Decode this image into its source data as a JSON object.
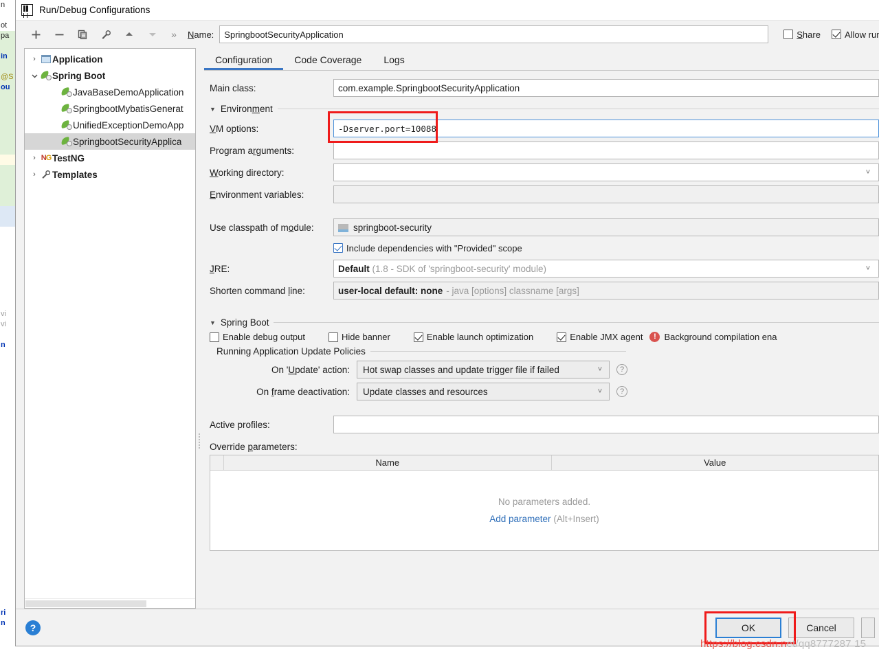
{
  "window": {
    "title": "Run/Debug Configurations",
    "logo_icon": "intellij-idea-logo-icon"
  },
  "toolbar": {
    "add_icon": "plus-icon",
    "remove_icon": "minus-icon",
    "copy_icon": "copy-icon",
    "edit_templates_icon": "wrench-icon",
    "move_up_icon": "arrow-up-icon",
    "move_down_icon": "arrow-down-icon",
    "overflow_label": "»"
  },
  "name_row": {
    "label": "Name:",
    "label_mnemonic": "N",
    "value": "SpringbootSecurityApplication",
    "share_label": "Share",
    "share_mnemonic": "S",
    "share_checked": false,
    "allow_running_label": "Allow running",
    "allow_running_checked": true
  },
  "tree": {
    "items": [
      {
        "label": "Application",
        "icon": "application-icon",
        "twisty": "›",
        "level": 0,
        "bold": true,
        "selected": false
      },
      {
        "label": "Spring Boot",
        "icon": "spring-boot-icon",
        "twisty": "⌄",
        "level": 0,
        "bold": true,
        "selected": false
      },
      {
        "label": "JavaBaseDemoApplication",
        "icon": "spring-leaf-icon",
        "twisty": "",
        "level": 1,
        "bold": false,
        "selected": false
      },
      {
        "label": "SpringbootMybatisGenerat",
        "icon": "spring-leaf-icon",
        "twisty": "",
        "level": 1,
        "bold": false,
        "selected": false
      },
      {
        "label": "UnifiedExceptionDemoApp",
        "icon": "spring-leaf-icon",
        "twisty": "",
        "level": 1,
        "bold": false,
        "selected": false
      },
      {
        "label": "SpringbootSecurityApplica",
        "icon": "spring-leaf-icon",
        "twisty": "",
        "level": 1,
        "bold": false,
        "selected": true
      },
      {
        "label": "TestNG",
        "icon": "testng-icon",
        "twisty": "›",
        "level": 0,
        "bold": true,
        "selected": false
      },
      {
        "label": "Templates",
        "icon": "wrench-icon",
        "twisty": "›",
        "level": 0,
        "bold": true,
        "selected": false
      }
    ]
  },
  "tabs": [
    {
      "label": "Configuration",
      "active": true
    },
    {
      "label": "Code Coverage",
      "active": false
    },
    {
      "label": "Logs",
      "active": false
    }
  ],
  "form": {
    "main_class": {
      "label": "Main class:",
      "value": "com.example.SpringbootSecurityApplication"
    },
    "environment_section": {
      "title": "Environment",
      "mnemonic": "m",
      "expanded": true,
      "triangle": "▼"
    },
    "vm_options": {
      "label": "VM options:",
      "label_mnemonic": "V",
      "value": "-Dserver.port=10088",
      "highlighted": true
    },
    "program_arguments": {
      "label": "Program arguments:",
      "label_mnemonic": "g",
      "value": ""
    },
    "working_directory": {
      "label": "Working directory:",
      "label_mnemonic": "W",
      "value": "",
      "has_dropdown": true
    },
    "environment_variables": {
      "label": "Environment variables:",
      "label_mnemonic": "E",
      "value": ""
    },
    "classpath_module": {
      "label": "Use classpath of module:",
      "label_mnemonic": "o",
      "value": "springboot-security",
      "icon": "module-icon"
    },
    "include_provided": {
      "label": "Include dependencies with \"Provided\" scope",
      "checked": true
    },
    "jre": {
      "label": "JRE:",
      "label_mnemonic": "J",
      "value_bold": "Default",
      "value_muted": "(1.8 - SDK of 'springboot-security' module)",
      "has_dropdown": true
    },
    "shorten_command_line": {
      "label": "Shorten command line:",
      "label_mnemonic": "l",
      "value_bold": "user-local default: none",
      "value_muted": "- java [options] classname [args]"
    }
  },
  "spring_boot_section": {
    "title": "Spring Boot",
    "mnemonic": "g",
    "triangle": "▼",
    "checkboxes": [
      {
        "label": "Enable debug output",
        "mnemonic": "d",
        "checked": false
      },
      {
        "label": "Hide banner",
        "mnemonic": "H",
        "checked": false
      },
      {
        "label": "Enable launch optimization",
        "mnemonic": "z",
        "checked": true
      },
      {
        "label": "Enable JMX agent",
        "mnemonic": "X",
        "checked": true
      }
    ],
    "warning": {
      "icon": "error-circle-icon",
      "text": "Background compilation ena"
    }
  },
  "update_policies": {
    "title": "Running Application Update Policies",
    "rows": [
      {
        "label": "On 'Update' action:",
        "mnemonic": "U",
        "value": "Hot swap classes and update trigger file if failed",
        "help_icon": "question-mark-icon"
      },
      {
        "label": "On frame deactivation:",
        "mnemonic": "f",
        "value": "Update classes and resources",
        "help_icon": "question-mark-icon"
      }
    ]
  },
  "active_profiles": {
    "label": "Active profiles:",
    "value": ""
  },
  "override_parameters": {
    "label": "Override parameters:",
    "label_mnemonic": "p",
    "columns": [
      "Name",
      "Value"
    ],
    "rows": [],
    "empty_text": "No parameters added.",
    "add_link": "Add parameter",
    "add_link_hint": "(Alt+Insert)"
  },
  "footer": {
    "help_icon": "question-mark-icon",
    "ok_label": "OK",
    "ok_highlighted": true,
    "cancel_label": "Cancel"
  },
  "watermark": {
    "text": "https://blog.csdn.net/qq8777287 15"
  },
  "background_editor": {
    "lines": [
      "n",
      "ot",
      "pa",
      "in",
      "@S",
      "ou",
      "",
      "",
      "",
      "",
      "",
      "",
      "",
      "",
      "",
      "",
      "vi",
      "vi",
      "",
      "n",
      "",
      "ri",
      "n"
    ]
  },
  "colors": {
    "accent": "#3a76c4",
    "annotation_red": "#ef1b1b",
    "link_blue": "#2b6cb8",
    "warning_red": "#d9534f",
    "spring_green": "#6db33f",
    "selection_gray": "#d6d6d6"
  }
}
